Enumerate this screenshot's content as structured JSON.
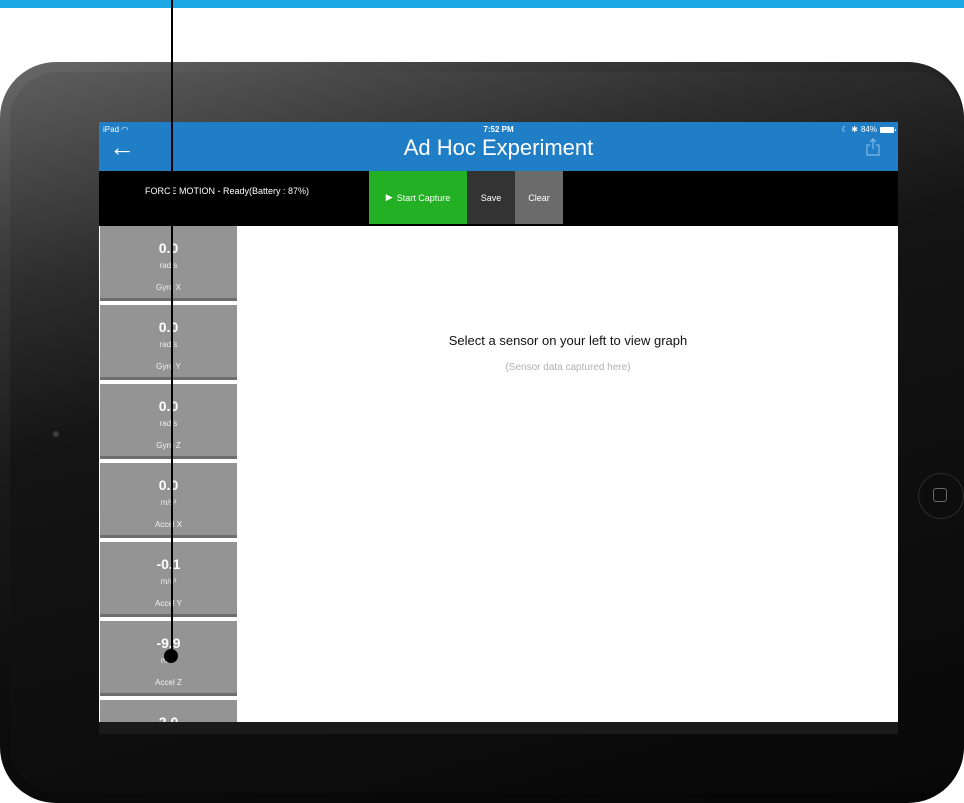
{
  "status_bar": {
    "device": "iPad",
    "time": "7:52 PM",
    "battery_text": "84%"
  },
  "navbar": {
    "title": "Ad Hoc Experiment",
    "back_icon": "back-arrow-icon",
    "share_icon": "share-icon",
    "color": "#1f7ec5"
  },
  "toolbar": {
    "device_status": "FORCE MOTION - Ready(Battery : 87%)",
    "start_label": "Start Capture",
    "save_label": "Save",
    "clear_label": "Clear",
    "start_color": "#24b024"
  },
  "sensors": [
    {
      "value": "0.0",
      "unit": "rad/s",
      "label": "Gyro X"
    },
    {
      "value": "0.0",
      "unit": "rad/s",
      "label": "Gyro Y"
    },
    {
      "value": "0.0",
      "unit": "rad/s",
      "label": "Gyro Z"
    },
    {
      "value": "0.0",
      "unit": "m/s²",
      "label": "Accel X"
    },
    {
      "value": "-0.1",
      "unit": "m/s²",
      "label": "Accel Y"
    },
    {
      "value": "-9.9",
      "unit": "m/s²",
      "label": "Accel Z"
    },
    {
      "value": "2.0",
      "unit": "",
      "label": ""
    }
  ],
  "graph": {
    "hint": "Select a sensor on your left to view graph",
    "sub_hint": "(Sensor data captured here)"
  }
}
